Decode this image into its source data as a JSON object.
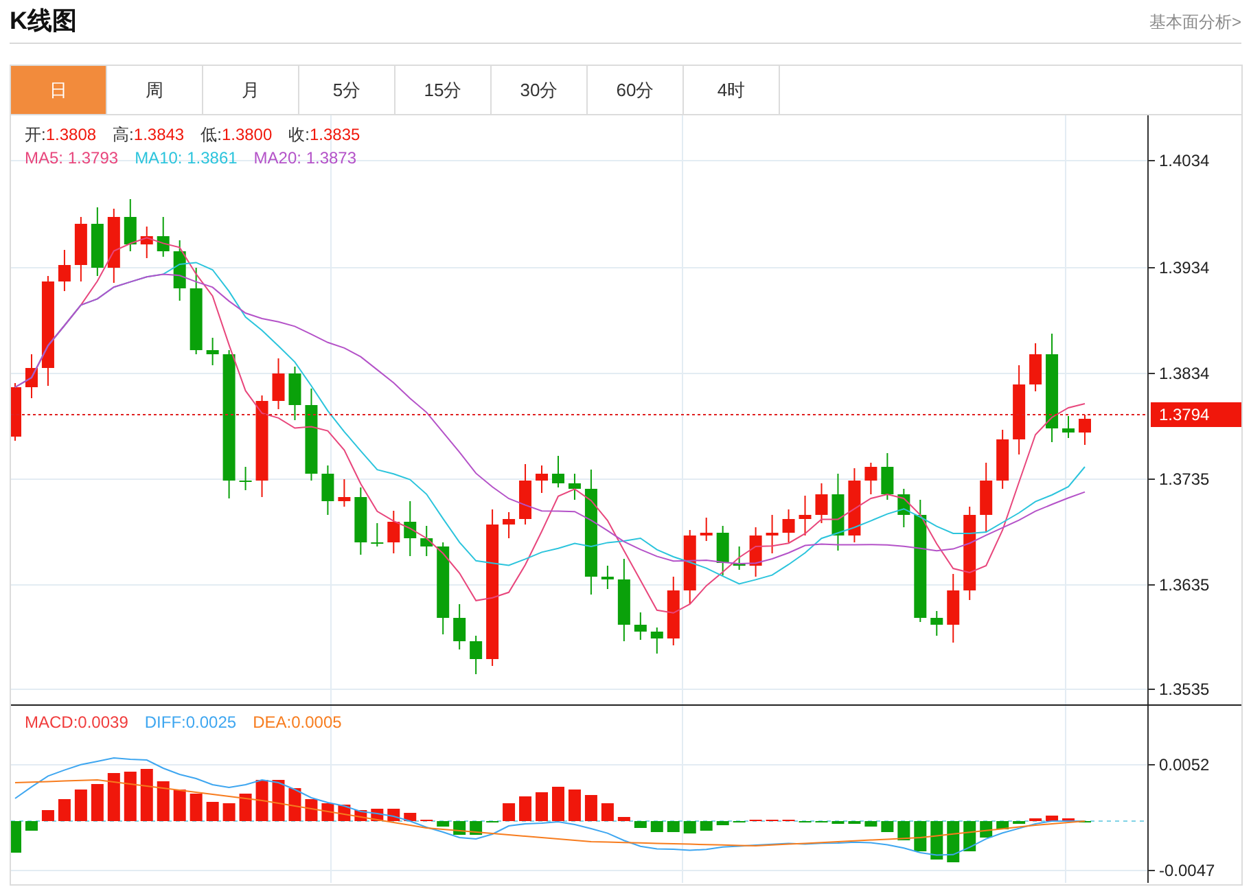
{
  "header": {
    "title": "K线图",
    "link": "基本面分析>"
  },
  "tabs": [
    {
      "label": "日",
      "selected": true
    },
    {
      "label": "周",
      "selected": false
    },
    {
      "label": "月",
      "selected": false
    },
    {
      "label": "5分",
      "selected": false
    },
    {
      "label": "15分",
      "selected": false
    },
    {
      "label": "30分",
      "selected": false
    },
    {
      "label": "60分",
      "selected": false
    },
    {
      "label": "4时",
      "selected": false
    }
  ],
  "price_chart": {
    "ohlc": [
      {
        "label": "开:",
        "value": "1.3808"
      },
      {
        "label": "高:",
        "value": "1.3843"
      },
      {
        "label": "低:",
        "value": "1.3800"
      },
      {
        "label": "收:",
        "value": "1.3835"
      }
    ],
    "ma_legend": [
      {
        "label": "MA5:",
        "value": "1.3793",
        "color": "#e8467c"
      },
      {
        "label": "MA10:",
        "value": "1.3861",
        "color": "#2bc4dc"
      },
      {
        "label": "MA20:",
        "value": "1.3873",
        "color": "#b452c8"
      }
    ],
    "y_ticks": [
      "1.4034",
      "1.3934",
      "1.3834",
      "1.3735",
      "1.3635",
      "1.3535"
    ],
    "current_price": "1.3794"
  },
  "macd_chart": {
    "legend": [
      {
        "label": "MACD:",
        "value": "0.0039",
        "color": "#f03c3c"
      },
      {
        "label": "DIFF:",
        "value": "0.0025",
        "color": "#3ea6f0"
      },
      {
        "label": "DEA:",
        "value": "0.0005",
        "color": "#f77c1e"
      }
    ],
    "y_ticks": [
      "0.0052",
      "-0.0047"
    ]
  }
}
